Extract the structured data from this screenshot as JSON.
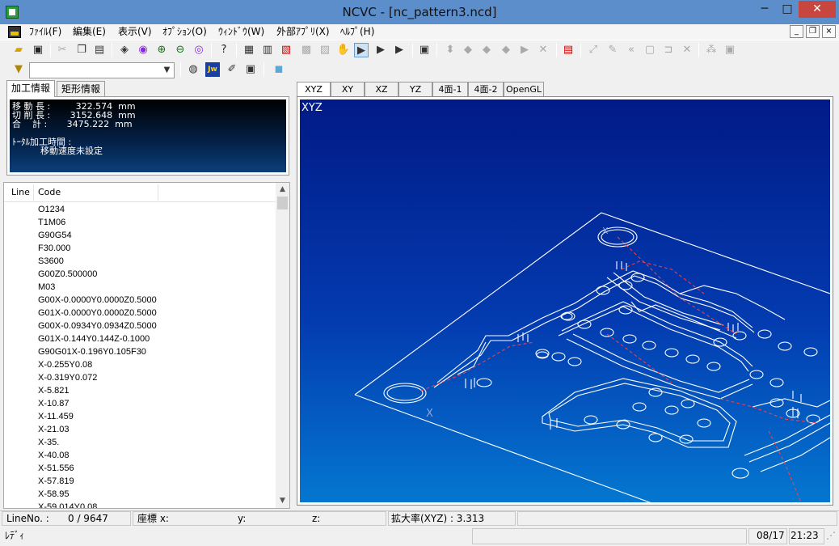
{
  "window": {
    "title": "NCVC - [nc_pattern3.ncd]",
    "min_glyph": "─",
    "max_glyph": "□",
    "close_glyph": "✕"
  },
  "menu": {
    "items": [
      "ﾌｧｲﾙ(F)",
      "編集(E)",
      "表示(V)",
      "ｵﾌﾟｼｮﾝ(O)",
      "ｳｨﾝﾄﾞｳ(W)",
      "外部ｱﾌﾟﾘ(X)",
      "ﾍﾙﾌﾟ(H)"
    ],
    "mdi_min": "_",
    "mdi_restore": "❐",
    "mdi_close": "×"
  },
  "toolbar": {
    "combo_value": ""
  },
  "info_panel": {
    "tabs": [
      "加工情報",
      "矩形情報"
    ],
    "lines": [
      "移 動 長 :         322.574  mm",
      "切 削 長 :       3152.648  mm",
      "合    計 :       3475.222  mm",
      "",
      "ﾄｰﾀﾙ加工時間 :",
      "          移動速度未設定"
    ]
  },
  "code_list": {
    "columns": [
      "Line",
      "Code"
    ],
    "rows": [
      "O1234",
      "T1M06",
      "G90G54",
      "F30.000",
      "S3600",
      "G00Z0.500000",
      "M03",
      "G00X-0.0000Y0.0000Z0.5000",
      "G01X-0.0000Y0.0000Z0.5000",
      "G00X-0.0934Y0.0934Z0.5000",
      "G01X-0.144Y0.144Z-0.1000",
      "G90G01X-0.196Y0.105F30",
      "X-0.255Y0.08",
      "X-0.319Y0.072",
      "X-5.821",
      "X-10.87",
      "X-11.459",
      "X-21.03",
      "X-35.",
      "X-40.08",
      "X-51.556",
      "X-57.819",
      "X-58.95",
      "X-59.014Y0.08"
    ]
  },
  "view": {
    "tabs": [
      "XYZ",
      "XY",
      "XZ",
      "YZ",
      "4面-1",
      "4面-2",
      "OpenGL"
    ],
    "active_tab": "XYZ",
    "overlay_label": "XYZ",
    "axis_label": "X",
    "axis_label2": "X",
    "colors": {
      "path": "#ffffff",
      "rapid": "#ff4040",
      "bg_top": "#021a86",
      "bg_bottom": "#0477d0"
    }
  },
  "status": {
    "lineno_label": "LineNo. :",
    "lineno_value": "0 /  9647",
    "coord_label": "座標  x:",
    "y_label": "y:",
    "z_label": "z:",
    "zoom_label": "拡大率(XYZ) :  3.313",
    "ready": "ﾚﾃﾞｨ",
    "date": "08/17",
    "time": "21:23"
  }
}
